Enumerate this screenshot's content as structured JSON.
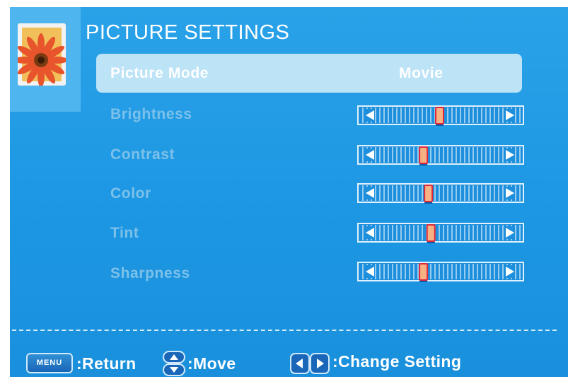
{
  "title": "PICTURE SETTINGS",
  "picture_mode": {
    "label": "Picture Mode",
    "value": "Movie"
  },
  "settings": [
    {
      "label": "Brightness",
      "level": 0.5
    },
    {
      "label": "Contrast",
      "level": 0.37
    },
    {
      "label": "Color",
      "level": 0.41
    },
    {
      "label": "Tint",
      "level": 0.43
    },
    {
      "label": "Sharpness",
      "level": 0.37
    }
  ],
  "footer": {
    "menu_key": "MENU",
    "return_label": ":Return",
    "move_label": ":Move",
    "change_label": ":Change Setting"
  },
  "colors": {
    "background": "#1d97e3",
    "highlight": "#bde3f7",
    "inactive_label": "#7cc1ea",
    "slider_handle": "#f7b183",
    "slider_handle_border": "#e3263a"
  }
}
